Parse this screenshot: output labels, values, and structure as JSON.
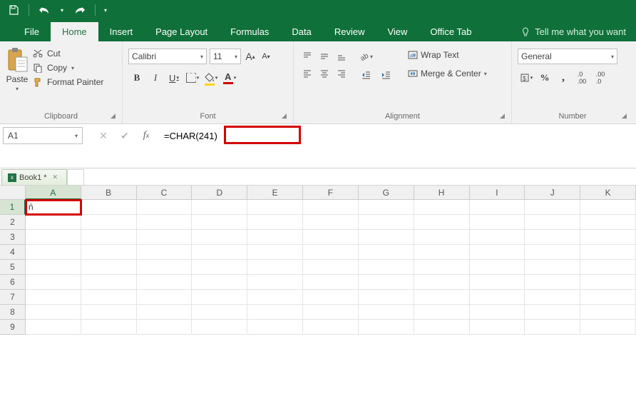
{
  "app": {
    "name": "Excel"
  },
  "qat": {
    "save": "Save",
    "undo": "Undo",
    "redo": "Redo"
  },
  "tabs": {
    "file": "File",
    "home": "Home",
    "insert": "Insert",
    "pagelayout": "Page Layout",
    "formulas": "Formulas",
    "data": "Data",
    "review": "Review",
    "view": "View",
    "officetab": "Office Tab",
    "tellme": "Tell me what you want"
  },
  "ribbon": {
    "clipboard": {
      "label": "Clipboard",
      "paste": "Paste",
      "cut": "Cut",
      "copy": "Copy",
      "format_painter": "Format Painter"
    },
    "font": {
      "label": "Font",
      "name": "Calibri",
      "size": "11",
      "bold": "B",
      "italic": "I",
      "underline": "U",
      "font_color_letter": "A",
      "fill_letter": ""
    },
    "alignment": {
      "label": "Alignment",
      "wrap": "Wrap Text",
      "merge": "Merge & Center"
    },
    "number": {
      "label": "Number",
      "format": "General",
      "percent": "%",
      "comma": ",",
      "inc_dec": ".0",
      "dec_dec": ".00"
    }
  },
  "formula_bar": {
    "name_box": "A1",
    "formula": "=CHAR(241)"
  },
  "workbook": {
    "tab": "Book1 *"
  },
  "grid": {
    "columns": [
      "A",
      "B",
      "C",
      "D",
      "E",
      "F",
      "G",
      "H",
      "I",
      "J",
      "K"
    ],
    "rows": [
      "1",
      "2",
      "3",
      "4",
      "5",
      "6",
      "7",
      "8",
      "9"
    ],
    "selected_col": "A",
    "selected_row": "1",
    "a1_value": "ñ"
  }
}
